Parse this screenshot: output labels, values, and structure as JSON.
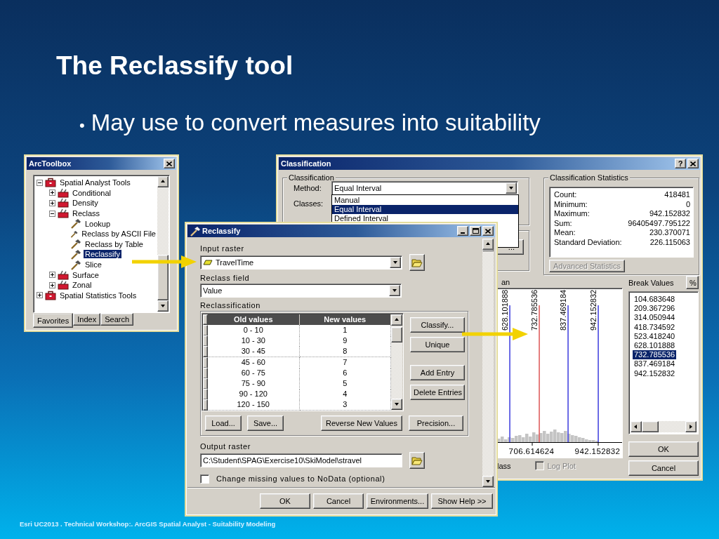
{
  "slide": {
    "title": "The Reclassify tool",
    "bullets": [
      {
        "marker": "•",
        "text": "May use to convert measures into suitability"
      }
    ],
    "footer": "Esri UC2013 . Technical Workshop:.  ArcGIS Spatial Analyst - Suitability Modeling"
  },
  "arctoolbox": {
    "title": "ArcToolbox",
    "tree": [
      {
        "label": "Spatial Analyst Tools",
        "kind": "toolbox",
        "expanded": true,
        "selected": false,
        "children": [
          {
            "label": "Conditional",
            "kind": "toolset",
            "expanded": false,
            "selected": false
          },
          {
            "label": "Density",
            "kind": "toolset",
            "expanded": false,
            "selected": false
          },
          {
            "label": "Reclass",
            "kind": "toolset",
            "expanded": true,
            "selected": false,
            "children": [
              {
                "label": "Lookup",
                "kind": "tool",
                "selected": false
              },
              {
                "label": "Reclass by ASCII File",
                "kind": "tool",
                "selected": false
              },
              {
                "label": "Reclass by Table",
                "kind": "tool",
                "selected": false
              },
              {
                "label": "Reclassify",
                "kind": "tool",
                "selected": true
              },
              {
                "label": "Slice",
                "kind": "tool",
                "selected": false
              }
            ]
          },
          {
            "label": "Surface",
            "kind": "toolset",
            "expanded": false,
            "selected": false
          },
          {
            "label": "Zonal",
            "kind": "toolset",
            "expanded": false,
            "selected": false
          }
        ]
      },
      {
        "label": "Spatial Statistics Tools",
        "kind": "toolbox",
        "expanded": false,
        "selected": false
      }
    ],
    "tabs": [
      {
        "label": "Favorites",
        "selected": true
      },
      {
        "label": "Index",
        "selected": false
      },
      {
        "label": "Search",
        "selected": false
      }
    ]
  },
  "classification": {
    "title": "Classification",
    "help_button": "?",
    "group_title": "Classification",
    "method_label": "Method:",
    "method_value": "Equal Interval",
    "method_options": [
      {
        "label": "Manual",
        "selected": false
      },
      {
        "label": "Equal Interval",
        "selected": true
      },
      {
        "label": "Defined Interval",
        "selected": false
      }
    ],
    "classes_label": "Classes:",
    "partial_button": "...",
    "stats": {
      "title": "Classification Statistics",
      "rows": [
        {
          "label": "Count:",
          "value": "418481"
        },
        {
          "label": "Minimum:",
          "value": "0"
        },
        {
          "label": "Maximum:",
          "value": "942.152832"
        },
        {
          "label": "Sum:",
          "value": "96405497.795122"
        },
        {
          "label": "Mean:",
          "value": "230.370071"
        },
        {
          "label": "Standard Deviation:",
          "value": "226.115063"
        }
      ]
    },
    "advanced_statistics": {
      "label": "Advanced Statistics",
      "disabled": true
    },
    "histogram": {
      "title": "an",
      "break_lines": [
        {
          "label": "628.101888",
          "selected": false
        },
        {
          "label": "732.785536",
          "selected": true
        },
        {
          "label": "837.469184",
          "selected": false
        },
        {
          "label": "942.152832",
          "selected": false
        }
      ],
      "axis_labels": [
        "706.614624",
        "942.152832"
      ]
    },
    "break_values": {
      "label": "Break Values",
      "percent_button": "%",
      "items": [
        {
          "value": "104.683648",
          "selected": false
        },
        {
          "value": "209.367296",
          "selected": false
        },
        {
          "value": "314.050944",
          "selected": false
        },
        {
          "value": "418.734592",
          "selected": false
        },
        {
          "value": "523.418240",
          "selected": false
        },
        {
          "value": "628.101888",
          "selected": false
        },
        {
          "value": "732.785536",
          "selected": true
        },
        {
          "value": "837.469184",
          "selected": false
        },
        {
          "value": "942.152832",
          "selected": false
        }
      ]
    },
    "class_label": "lass",
    "log_plot": {
      "label": "Log Plot",
      "checked": false,
      "disabled": true
    },
    "buttons": [
      "OK",
      "Cancel"
    ]
  },
  "reclassify": {
    "title": "Reclassify",
    "input_raster": {
      "label": "Input raster",
      "value": "TravelTime"
    },
    "reclass_field": {
      "label": "Reclass field",
      "value": "Value"
    },
    "reclassification": {
      "label": "Reclassification",
      "columns": [
        "Old values",
        "New values"
      ],
      "rows": [
        [
          "0 - 10",
          "1"
        ],
        [
          "10 - 30",
          "9"
        ],
        [
          "30 - 45",
          "8"
        ],
        [
          "45 - 60",
          "7"
        ],
        [
          "60 - 75",
          "6"
        ],
        [
          "75 - 90",
          "5"
        ],
        [
          "90 - 120",
          "4"
        ],
        [
          "120 - 150",
          "3"
        ]
      ],
      "side_buttons": [
        "Classify...",
        "Unique",
        "Add Entry",
        "Delete Entries"
      ],
      "bottom_buttons": [
        "Load...",
        "Save...",
        "Reverse New Values",
        "Precision..."
      ]
    },
    "output_raster": {
      "label": "Output raster",
      "value": "C:\\Student\\SPAG\\Exercise10\\SkiModel\\stravel"
    },
    "missing_to_nodata": {
      "label": "Change missing values to NoData (optional)",
      "checked": false
    },
    "buttons": [
      "OK",
      "Cancel",
      "Environments...",
      "Show Help >>"
    ]
  }
}
